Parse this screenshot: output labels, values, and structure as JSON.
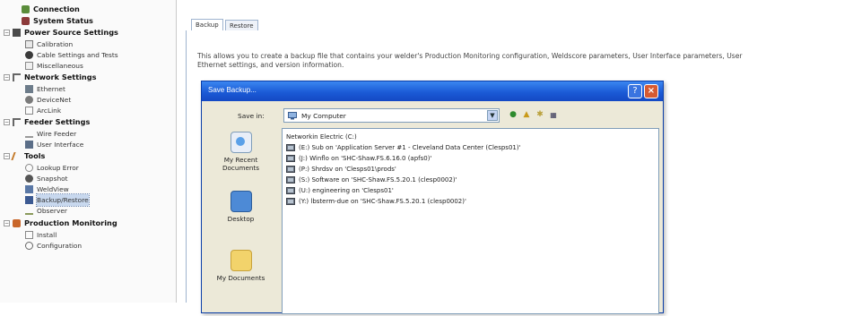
{
  "tree": {
    "items": [
      {
        "label": "Connection",
        "level": "category",
        "icon": "connection-icon"
      },
      {
        "label": "System Status",
        "level": "category",
        "icon": "system-status-icon"
      },
      {
        "label": "Power Source Settings",
        "level": "category",
        "icon": "power-source-icon"
      },
      {
        "label": "Calibration",
        "level": "child",
        "icon": "calibration-icon"
      },
      {
        "label": "Cable Settings and Tests",
        "level": "child",
        "icon": "cable-icon"
      },
      {
        "label": "Miscellaneous",
        "level": "child",
        "icon": "misc-icon"
      },
      {
        "label": "Network Settings",
        "level": "category",
        "icon": "network-icon"
      },
      {
        "label": "Ethernet",
        "level": "child",
        "icon": "ethernet-icon"
      },
      {
        "label": "DeviceNet",
        "level": "child",
        "icon": "devicenet-icon"
      },
      {
        "label": "ArcLink",
        "level": "child",
        "icon": "arclink-icon"
      },
      {
        "label": "Feeder Settings",
        "level": "category",
        "icon": "feeder-icon"
      },
      {
        "label": "Wire Feeder",
        "level": "child",
        "icon": "wire-feeder-icon"
      },
      {
        "label": "User Interface",
        "level": "child",
        "icon": "user-interface-icon"
      },
      {
        "label": "Tools",
        "level": "category",
        "icon": "tools-icon"
      },
      {
        "label": "Lookup Error",
        "level": "child",
        "icon": "lookup-error-icon"
      },
      {
        "label": "Snapshot",
        "level": "child",
        "icon": "snapshot-icon"
      },
      {
        "label": "WeldView",
        "level": "child",
        "icon": "weldview-icon"
      },
      {
        "label": "Backup/Restore",
        "level": "child",
        "icon": "backup-restore-icon"
      },
      {
        "label": "Observer",
        "level": "child",
        "icon": "observer-icon"
      },
      {
        "label": "Production Monitoring",
        "level": "category",
        "icon": "production-monitoring-icon"
      },
      {
        "label": "Install",
        "level": "child",
        "icon": "install-icon"
      },
      {
        "label": "Configuration",
        "level": "child",
        "icon": "configuration-icon"
      }
    ]
  },
  "tabs": [
    {
      "label": "Backup"
    },
    {
      "label": "Restore"
    }
  ],
  "description": {
    "line1": "This allows you to create a backup file that contains your welder's Production Monitoring configuration, Weldscore parameters, User Interface parameters, User",
    "line2": "Ethernet settings, and version information."
  },
  "dialog": {
    "title": "Save Backup...",
    "save_in_label": "Save in:",
    "save_in_value": "My Computer",
    "places": [
      {
        "label": "My Recent Documents",
        "icon": "recent-documents-icon"
      },
      {
        "label": "Desktop",
        "icon": "desktop-icon"
      },
      {
        "label": "My Documents",
        "icon": "my-documents-icon"
      }
    ],
    "files": [
      "Networkin Electric (C:)",
      "(E:) Sub on 'Application Server #1 - Cleveland Data Center (Clesps01)'",
      "(J:) Winflo on 'SHC-Shaw.FS.6.16.0 (apfs0)'",
      "(P:) Shrdsv on 'Clesps01\\prods'",
      "(S:) Software on 'SHC-Shaw.FS.5.20.1 (clesp0002)'",
      "(U:) engineering on 'Clesps01'",
      "(Y:) lbsterm-due on 'SHC-Shaw.FS.5.20.1 (clesp0002)'"
    ]
  },
  "colors": {
    "title_bar": "#1b5bd6",
    "dialog_bg": "#ece9d8",
    "close_button": "#d65a32",
    "tab_border": "#9fb4cf"
  }
}
